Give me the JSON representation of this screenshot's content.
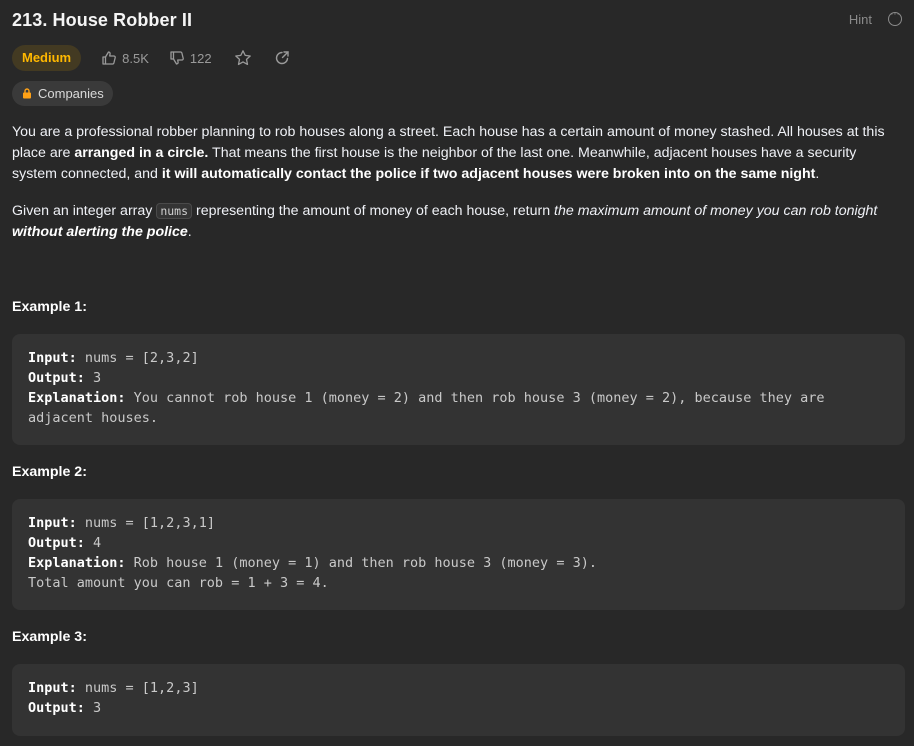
{
  "problem": {
    "title": "213. House Robber II",
    "hint_label": "Hint",
    "difficulty": "Medium",
    "likes": "8.5K",
    "dislikes": "122",
    "companies_label": "Companies"
  },
  "description": {
    "p1_a": "You are a professional robber planning to rob houses along a street. Each house has a certain amount of money stashed. All houses at this place are ",
    "p1_b": "arranged in a circle.",
    "p1_c": " That means the first house is the neighbor of the last one. Meanwhile, adjacent houses have a security system connected, and ",
    "p1_d": "it will automatically contact the police if two adjacent houses were broken into on the same night",
    "p1_e": ".",
    "p2_a": "Given an integer array ",
    "p2_code": "nums",
    "p2_b": " representing the amount of money of each house, return ",
    "p2_c": "the maximum amount of money you can rob tonight ",
    "p2_d": "without alerting the police",
    "p2_e": "."
  },
  "examples": [
    {
      "title": "Example 1:",
      "input_label": "Input:",
      "input": " nums = [2,3,2]",
      "output_label": "Output:",
      "output": " 3",
      "explanation_label": "Explanation:",
      "explanation": " You cannot rob house 1 (money = 2) and then rob house 3 (money = 2), because they are adjacent houses."
    },
    {
      "title": "Example 2:",
      "input_label": "Input:",
      "input": " nums = [1,2,3,1]",
      "output_label": "Output:",
      "output": " 4",
      "explanation_label": "Explanation:",
      "explanation": " Rob house 1 (money = 1) and then rob house 3 (money = 3).\nTotal amount you can rob = 1 + 3 = 4."
    },
    {
      "title": "Example 3:",
      "input_label": "Input:",
      "input": " nums = [1,2,3]",
      "output_label": "Output:",
      "output": " 3"
    }
  ],
  "colors": {
    "background": "#282828",
    "difficulty_medium": "#ffb800",
    "code_box": "#333333"
  }
}
